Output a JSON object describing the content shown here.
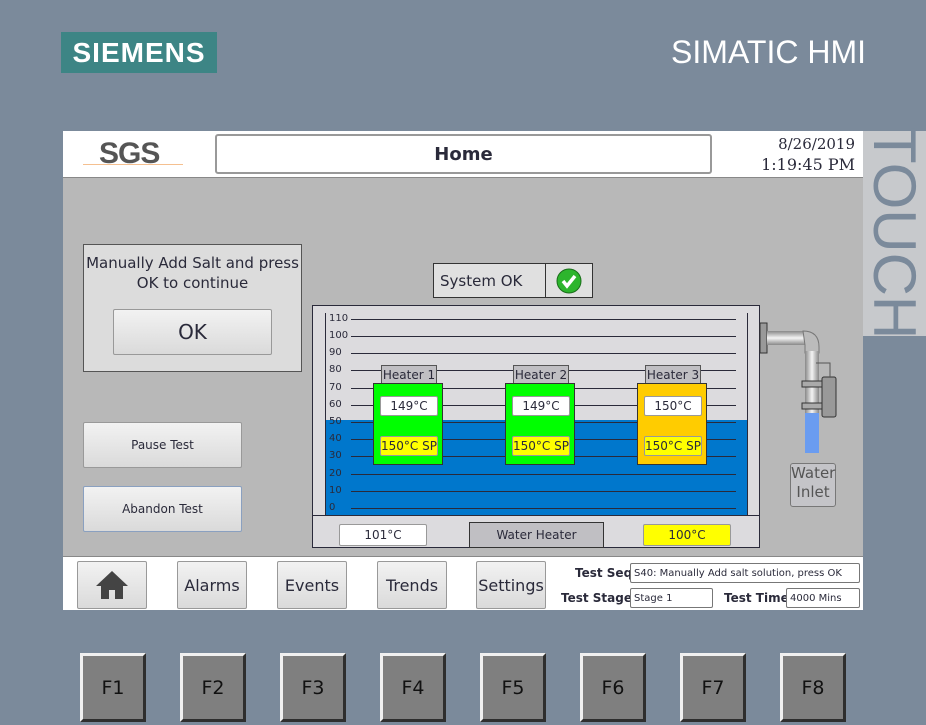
{
  "bezel": {
    "brand": "SIEMENS",
    "product": "SIMATIC HMI",
    "touch": "TOUCH"
  },
  "header": {
    "logo": "SGS",
    "title": "Home",
    "date": "8/26/2019",
    "time": "1:19:45 PM"
  },
  "prompt": {
    "message": "Manually Add Salt and press OK to continue",
    "ok_label": "OK"
  },
  "buttons": {
    "pause": "Pause Test",
    "abandon": "Abandon Test"
  },
  "system_status": {
    "label": "System OK",
    "icon": "check-circle-icon",
    "color": "#2db52d"
  },
  "tank": {
    "scale_ticks": [
      "110",
      "100",
      "90",
      "80",
      "70",
      "60",
      "50",
      "40",
      "30",
      "20",
      "10",
      "0"
    ],
    "level_percent": 51,
    "water_color": "#0077cc",
    "heaters": [
      {
        "label": "Heater 1",
        "temp": "149°C",
        "setpoint": "150°C SP",
        "color": "#00ff00"
      },
      {
        "label": "Heater 2",
        "temp": "149°C",
        "setpoint": "150°C SP",
        "color": "#00ff00"
      },
      {
        "label": "Heater 3",
        "temp": "150°C",
        "setpoint": "150°C SP",
        "color": "#ffcc00"
      }
    ],
    "left_temp": "101°C",
    "center_label": "Water Heater",
    "right_temp": "100°C",
    "inlet_label": "Water Inlet"
  },
  "nav": {
    "home_icon": "home-icon",
    "items": [
      "Alarms",
      "Events",
      "Trends",
      "Settings"
    ]
  },
  "test": {
    "seq_label": "Test Seq",
    "seq_value": "S40: Manually Add salt solution, press OK",
    "stage_label": "Test Stage",
    "stage_value": "Stage 1",
    "time_label": "Test Time",
    "time_value": "4000 Mins"
  },
  "fkeys": [
    "F1",
    "F2",
    "F3",
    "F4",
    "F5",
    "F6",
    "F7",
    "F8"
  ]
}
